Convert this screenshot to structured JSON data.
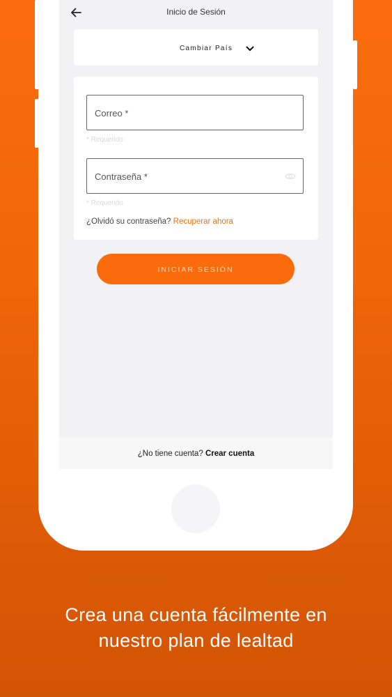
{
  "header": {
    "title": "Inicio de Sesión"
  },
  "country": {
    "label": "Cambiar País"
  },
  "form": {
    "email_label": "Correo *",
    "email_helper": "* Requerido",
    "password_label": "Contraseña *",
    "password_helper": "* Requerido",
    "forgot_text": "¿Olvidó su contraseña?",
    "recover_link": "Recuperar ahora"
  },
  "login_button": {
    "label": "INICIAR SESIÓN"
  },
  "signup": {
    "prompt": "¿No tiene cuenta?",
    "create_link": "Crear cuenta"
  },
  "tagline": {
    "line1": "Crea una cuenta fácilmente en",
    "line2": "nuestro plan de lealtad"
  },
  "icons": {
    "back": "back-arrow-icon",
    "chevron": "chevron-down-icon",
    "eye": "eye-icon"
  },
  "colors": {
    "accent": "#fa6c0b",
    "link": "#f07012",
    "background": "#f06608",
    "screen": "#f2f2f4"
  }
}
